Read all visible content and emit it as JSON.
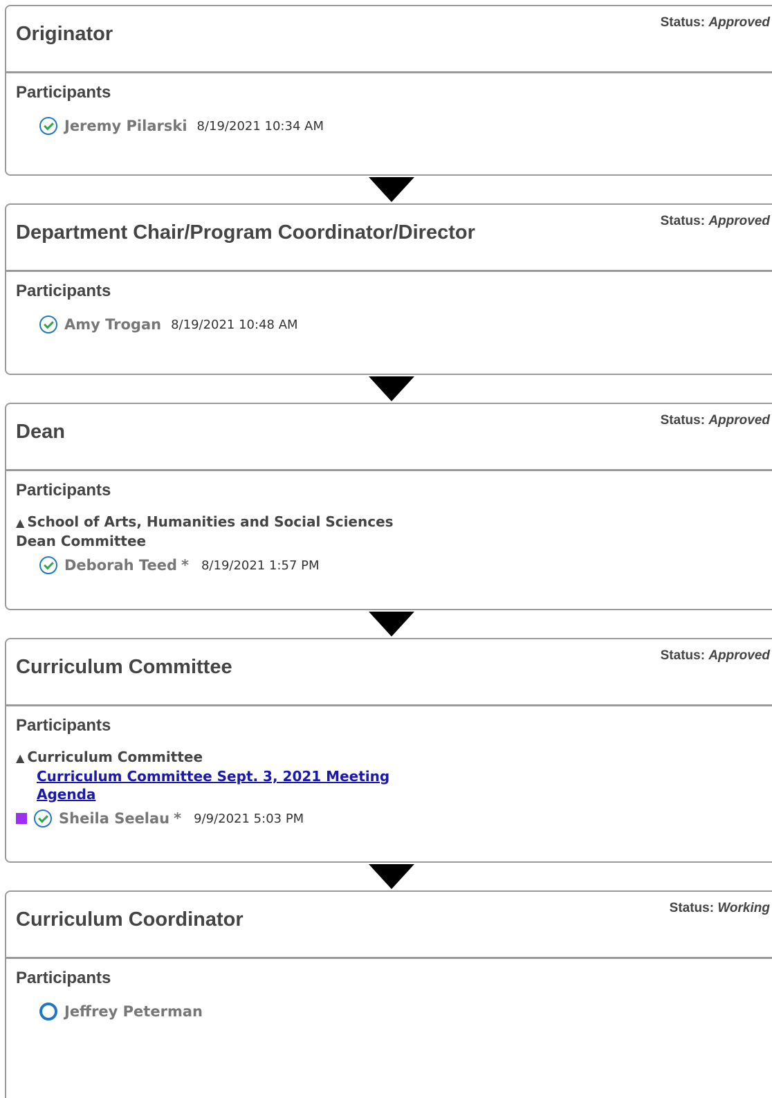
{
  "steps": [
    {
      "title": "Originator",
      "status_label": "Status:",
      "status_value": "Approved",
      "participants_label": "Participants",
      "participants": [
        {
          "name": "Jeremy Pilarski",
          "timestamp": "8/19/2021 10:34 AM",
          "state": "approved-icon"
        }
      ]
    },
    {
      "title": "Department Chair/Program Coordinator/Director",
      "status_label": "Status:",
      "status_value": "Approved",
      "participants_label": "Participants",
      "participants": [
        {
          "name": "Amy Trogan",
          "timestamp": "8/19/2021 10:48 AM",
          "state": "approved-icon"
        }
      ]
    },
    {
      "title": "Dean",
      "status_label": "Status:",
      "status_value": "Approved",
      "participants_label": "Participants",
      "group_line1": "School of Arts, Humanities and Social Sciences",
      "group_line2": "Dean Committee",
      "participants": [
        {
          "name": "Deborah Teed",
          "asterisk": "*",
          "timestamp": "8/19/2021 1:57 PM",
          "state": "approved-icon"
        }
      ]
    },
    {
      "title": "Curriculum Committee",
      "status_label": "Status:",
      "status_value": "Approved",
      "participants_label": "Participants",
      "group_line1": "Curriculum Committee",
      "agenda_line1": "Curriculum Committee Sept. 3, 2021 Meeting",
      "agenda_line2": "Agenda",
      "participants": [
        {
          "name": "Sheila Seelau",
          "asterisk": "*",
          "timestamp": "9/9/2021 5:03 PM",
          "state": "approved-icon"
        }
      ]
    },
    {
      "title": "Curriculum Coordinator",
      "status_label": "Status:",
      "status_value": "Working",
      "participants_label": "Participants",
      "participants": [
        {
          "name": "Jeffrey Peterman",
          "state": "pending-icon"
        }
      ]
    }
  ],
  "colors": {
    "approved_check": "#2ea84a",
    "icon_ring": "#1f79c2",
    "link": "#1a1aa6",
    "purple_marker": "#9b30f0"
  }
}
